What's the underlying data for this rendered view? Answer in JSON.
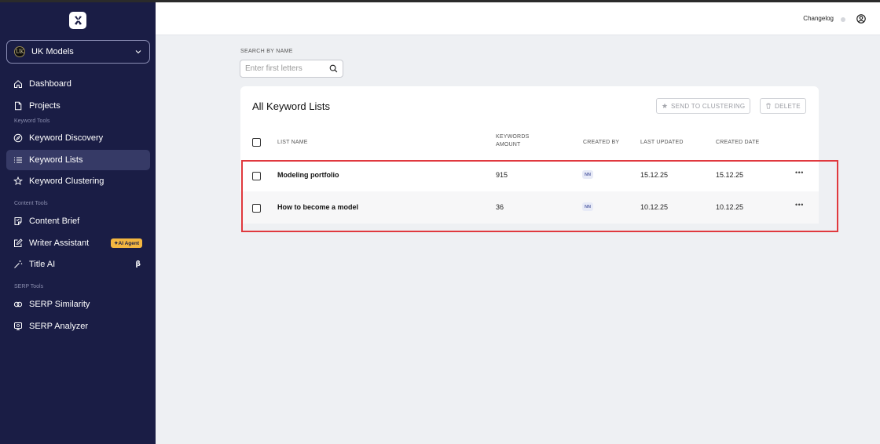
{
  "sidebar": {
    "workspace": {
      "avatar_text": "UK",
      "name": "UK Models"
    },
    "items": [
      {
        "label": "Dashboard",
        "icon": "home-icon"
      },
      {
        "label": "Projects",
        "icon": "file-icon"
      },
      {
        "label": "Keyword Discovery",
        "icon": "compass-icon"
      },
      {
        "label": "Keyword Lists",
        "icon": "list-icon"
      },
      {
        "label": "Keyword Clustering",
        "icon": "cluster-icon"
      },
      {
        "label": "Content Brief",
        "icon": "brief-icon"
      },
      {
        "label": "Writer Assistant",
        "icon": "edit-icon",
        "badge": "AI Agent"
      },
      {
        "label": "Title AI",
        "icon": "magic-wand-icon",
        "tag": "β"
      },
      {
        "label": "SERP Similarity",
        "icon": "link-icon"
      },
      {
        "label": "SERP Analyzer",
        "icon": "monitor-icon"
      }
    ],
    "sections": {
      "keyword_tools": "Keyword Tools",
      "content_tools": "Content Tools",
      "serp_tools": "SERP Tools"
    },
    "active_item": "Keyword Lists"
  },
  "topbar": {
    "changelog": "Changelog"
  },
  "search": {
    "label": "SEARCH BY NAME",
    "placeholder": "Enter first letters",
    "value": ""
  },
  "card": {
    "title": "All Keyword Lists",
    "send_button": "SEND TO CLUSTERING",
    "delete_button": "DELETE",
    "columns": {
      "list_name": "LIST NAME",
      "keywords_amount": "KEYWORDS AMOUNT",
      "created_by": "CREATED BY",
      "last_updated": "LAST UPDATED",
      "created_date": "CREATED DATE"
    },
    "rows": [
      {
        "name": "Modeling portfolio",
        "amount": "915",
        "created_by": "NN",
        "last_updated": "15.12.25",
        "created_date": "15.12.25"
      },
      {
        "name": "How to become a model",
        "amount": "36",
        "created_by": "NN",
        "last_updated": "10.12.25",
        "created_date": "10.12.25"
      }
    ]
  },
  "colors": {
    "sidebar_bg": "#1a1d45",
    "active_item": "#363a66",
    "highlight": "#e0393e",
    "badge": "#f4b740"
  }
}
